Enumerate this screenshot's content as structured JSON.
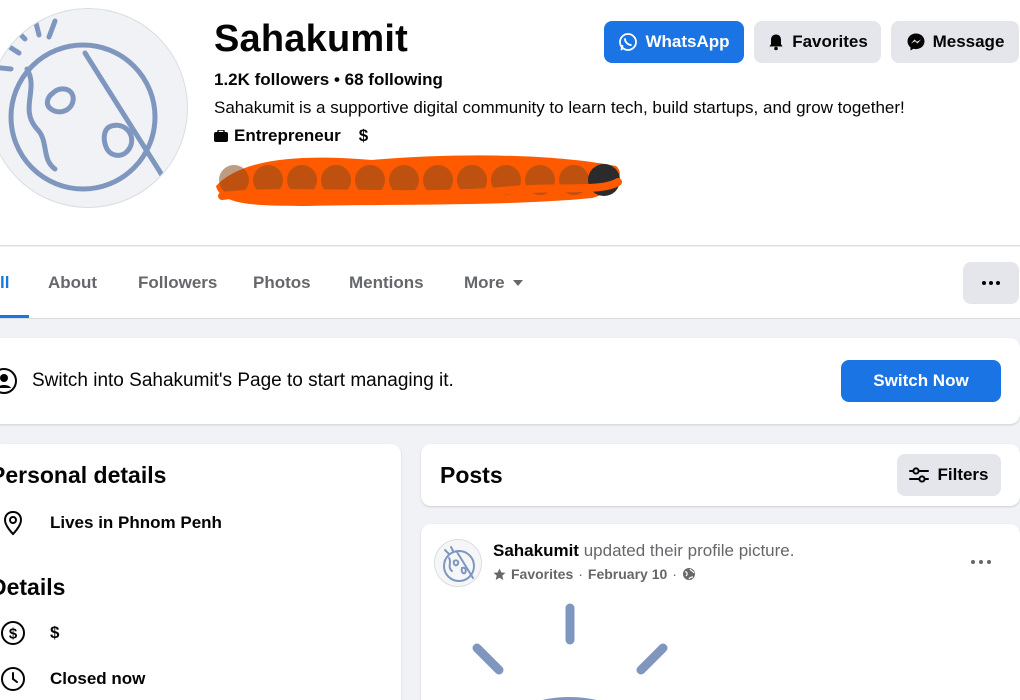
{
  "profile": {
    "name": "Sahakumit",
    "followers_line": "1.2K followers • 68 following",
    "bio": "Sahakumit is a supportive digital community to learn tech, build startups, and grow together!",
    "category": "Entrepreneur",
    "price": "$"
  },
  "header_buttons": {
    "whatsapp": "WhatsApp",
    "favorites": "Favorites",
    "message": "Message"
  },
  "tabs": [
    {
      "label": "ll"
    },
    {
      "label": "About"
    },
    {
      "label": "Followers"
    },
    {
      "label": "Photos"
    },
    {
      "label": "Mentions"
    },
    {
      "label": "More"
    }
  ],
  "switch_banner": {
    "text": "Switch into Sahakumit's Page to start managing it.",
    "button": "Switch Now"
  },
  "details": {
    "personal_title": "Personal details",
    "lives_in": "Lives in Phnom Penh",
    "details_title": "Details",
    "price": "$",
    "hours": "Closed now"
  },
  "posts": {
    "title": "Posts",
    "filters": "Filters"
  },
  "post": {
    "author": "Sahakumit",
    "action": "updated their profile picture.",
    "audience": "Favorites",
    "date": "February 10"
  },
  "colors": {
    "accent": "#1b74e4",
    "illustration": "#7f97bf",
    "redaction": "#ff5a00"
  }
}
